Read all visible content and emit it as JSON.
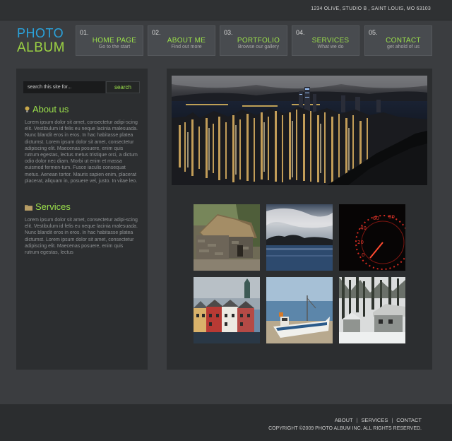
{
  "header": {
    "address": "1234 OLIVE, STUDIO B , SAINT LOUIS, MO 63103",
    "logo_line1": "PHOTO",
    "logo_line2": "ALBUM"
  },
  "nav": [
    {
      "num": "01.",
      "title": "HOME PAGE",
      "sub": "Go to the start"
    },
    {
      "num": "02.",
      "title": "ABOUT ME",
      "sub": "Find out more"
    },
    {
      "num": "03.",
      "title": "PORTFOLIO",
      "sub": "Browse our gallery"
    },
    {
      "num": "04.",
      "title": "SERVICES",
      "sub": "What we do"
    },
    {
      "num": "05.",
      "title": "CONTACT",
      "sub": "get ahold of us"
    }
  ],
  "sidebar": {
    "search_placeholder": "search this site for...",
    "search_button": "search",
    "about_title": "About us",
    "about_text": "Lorem ipsum dolor sit amet, consectetur adipi-scing elit. Vestibulum id felis eu neque lacinia malesuada. Nunc blandit eros in eros. In hac habitasse platea dictumst. Lorem ipsum dolor sit amet, consectetur adipiscing elit. Maecenas posuere, enim quis rutrum egestas, lectus metus tristique orci, a dictum odio dolor nec diam. Morbi ut enim et massa euismod fermen-tum. Fusce iaculis consequat metus. Aenean tortor. Mauris sapien enim, placerat placerat, aliquam in, posuere vel, justo. In vitae leo.",
    "services_title": "Services",
    "services_text": "Lorem ipsum dolor sit amet, consectetur adipi-scing elit. Vestibulum id felis eu neque lacinia malesuada. Nunc blandit eros in eros. In hac habitasse platea dictumst. Lorem ipsum dolor sit amet, consectetur adipiscing elit. Maecenas posuere, enim quis rutrum egestas, lectus"
  },
  "gallery": {
    "hero_icon": "city-skyline-night-photo",
    "thumbnails": [
      "stone-cottage-photo",
      "lake-island-photo",
      "speedometer-photo",
      "colorful-houses-photo",
      "fishing-boat-photo",
      "snowy-cabin-photo"
    ]
  },
  "footer": {
    "links": [
      "ABOUT",
      "SERVICES",
      "CONTACT"
    ],
    "copyright": "COPYRIGHT ©2009 PHOTO ALBUM INC. ALL RIGHTS RESERVED."
  },
  "colors": {
    "accent_green": "#9be04b",
    "logo_blue": "#2aa3dc",
    "logo_green": "#9bd143",
    "panel": "#2c2e30",
    "background": "#3b3d40"
  }
}
